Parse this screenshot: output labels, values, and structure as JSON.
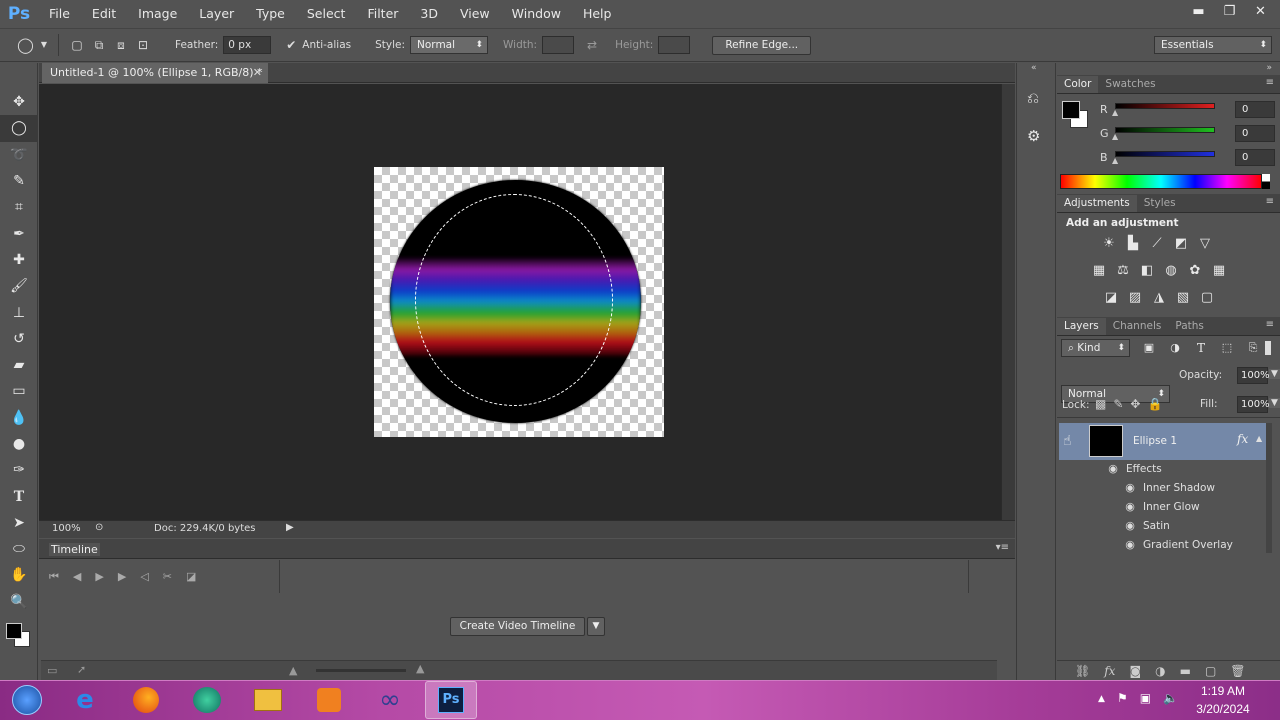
{
  "app": {
    "logo": "Ps"
  },
  "menu": [
    "File",
    "Edit",
    "Image",
    "Layer",
    "Type",
    "Select",
    "Filter",
    "3D",
    "View",
    "Window",
    "Help"
  ],
  "window_controls": {
    "minimize": "▬",
    "restore": "❐",
    "close": "✕"
  },
  "options": {
    "feather_label": "Feather:",
    "feather_value": "0 px",
    "antialias_label": "Anti-alias",
    "style_label": "Style:",
    "style_value": "Normal",
    "width_label": "Width:",
    "height_label": "Height:",
    "refine_edge": "Refine Edge...",
    "workspace": "Essentials"
  },
  "document": {
    "tab_title": "Untitled-1 @ 100% (Ellipse 1, RGB/8) *",
    "zoom": "100%",
    "doc_info": "Doc: 229.4K/0 bytes"
  },
  "timeline": {
    "title": "Timeline",
    "create_button": "Create Video Timeline"
  },
  "color_panel": {
    "tabs": [
      "Color",
      "Swatches"
    ],
    "channels": [
      {
        "label": "R",
        "value": "0",
        "color": "#e02020"
      },
      {
        "label": "G",
        "value": "0",
        "color": "#20c020"
      },
      {
        "label": "B",
        "value": "0",
        "color": "#2030e0"
      }
    ]
  },
  "adjustments_panel": {
    "tabs": [
      "Adjustments",
      "Styles"
    ],
    "heading": "Add an adjustment"
  },
  "layers_panel": {
    "tabs": [
      "Layers",
      "Channels",
      "Paths"
    ],
    "filter_kind": "Kind",
    "blend_mode": "Normal",
    "opacity_label": "Opacity:",
    "opacity_value": "100%",
    "lock_label": "Lock:",
    "fill_label": "Fill:",
    "fill_value": "100%",
    "layer_name": "Ellipse 1",
    "fx_badge": "fx",
    "effects_label": "Effects",
    "effects": [
      "Inner Shadow",
      "Inner Glow",
      "Satin",
      "Gradient Overlay"
    ]
  },
  "taskbar": {
    "time": "1:19 AM",
    "date": "3/20/2024",
    "apps": [
      "internet-explorer",
      "firefox",
      "messenger",
      "file-explorer",
      "media-player",
      "infinity-app",
      "photoshop"
    ]
  }
}
